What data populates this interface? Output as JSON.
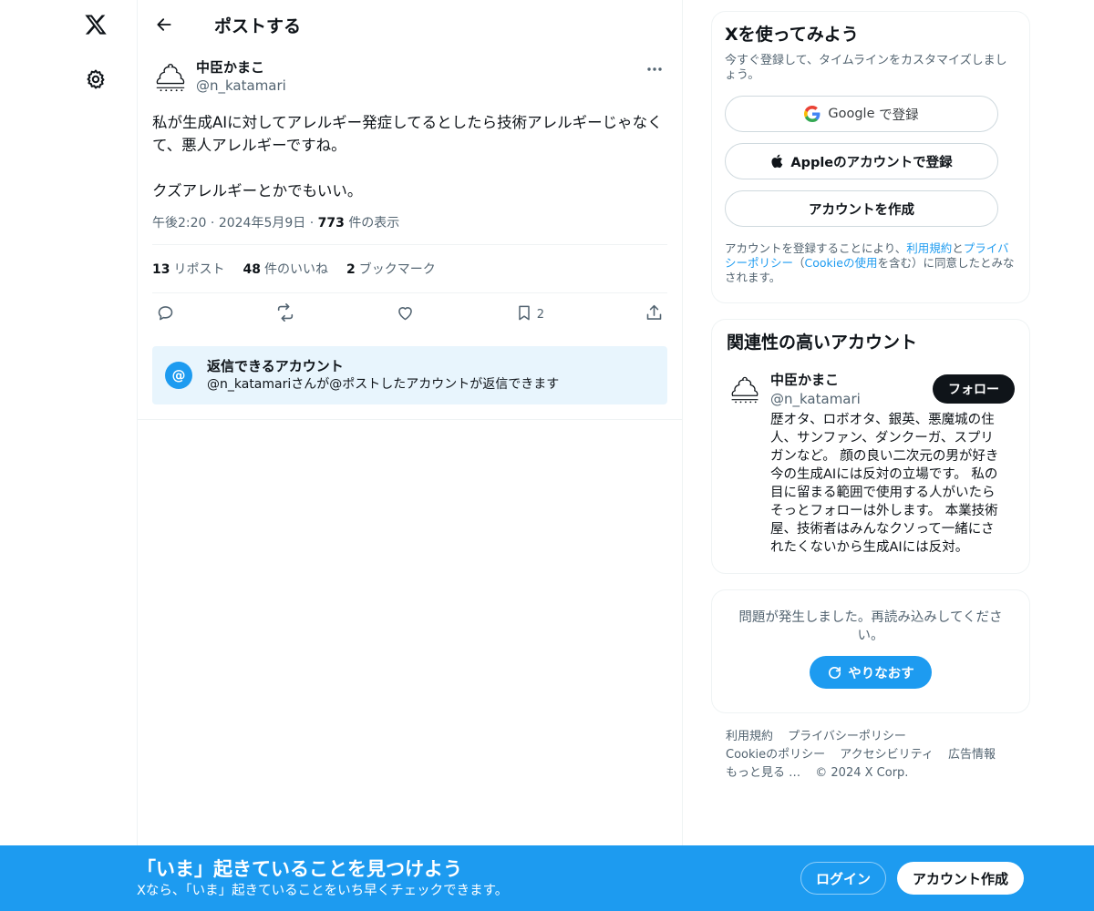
{
  "header": {
    "title": "ポストする"
  },
  "post": {
    "display_name": "中臣かまこ",
    "handle": "@n_katamari",
    "text": "私が生成AIに対してアレルギー発症してるとしたら技術アレルギーじゃなくて、悪人アレルギーですね。\n\nクズアレルギーとかでもいい。",
    "time": "午後2:20",
    "date": "2024年5月9日",
    "views_count": "773",
    "views_label": "件の表示",
    "reposts_count": "13",
    "reposts_label": "リポスト",
    "likes_count": "48",
    "likes_label": "件のいいね",
    "bookmarks_count": "2",
    "bookmarks_label": "ブックマーク",
    "bookmark_action_count": "2"
  },
  "reply_settings": {
    "title": "返信できるアカウント",
    "description": "@n_katamariさんが@ポストしたアカウントが返信できます"
  },
  "signup_card": {
    "title": "Xを使ってみよう",
    "subtitle": "今すぐ登録して、タイムラインをカスタマイズしましょう。",
    "google_label_brand": "Google",
    "google_label_suffix": " で登録",
    "apple_label": "Appleのアカウントで登録",
    "create_label": "アカウントを作成",
    "terms_prefix": "アカウントを登録することにより、",
    "terms_link": "利用規約",
    "terms_and": "と",
    "privacy_link": "プライバシーポリシー",
    "paren_open": "（",
    "cookie_link": "Cookieの使用",
    "terms_suffix": "を含む）に同意したとみなされます。"
  },
  "related": {
    "title": "関連性の高いアカウント",
    "display_name": "中臣かまこ",
    "handle": "@n_katamari",
    "follow_label": "フォロー",
    "bio": "歴オタ、ロボオタ、銀英、悪魔城の住人、サンファン、ダンクーガ、スプリガンなど。 顔の良い二次元の男が好き 今の生成AIには反対の立場です。 私の目に留まる範囲で使用する人がいたらそっとフォローは外します。 本業技術屋、技術者はみんなクソって一緒にされたくないから生成AIには反対。"
  },
  "error_card": {
    "message": "問題が発生しました。再読み込みしてください。",
    "retry_label": "やりなおす"
  },
  "footer": {
    "links": [
      "利用規約",
      "プライバシーポリシー",
      "Cookieのポリシー",
      "アクセシビリティ",
      "広告情報",
      "もっと見る …"
    ],
    "copyright": "© 2024 X Corp."
  },
  "banner": {
    "title": "「いま」起きていることを見つけよう",
    "subtitle": "Xなら、「いま」起きていることをいち早くチェックできます。",
    "login_label": "ログイン",
    "signup_label": "アカウント作成"
  },
  "icons": {
    "logo": "x-logo-icon",
    "settings": "gear-icon",
    "back": "arrow-left-icon",
    "more": "more-horizontal-icon",
    "reply": "reply-icon",
    "repost": "repost-icon",
    "like": "heart-icon",
    "bookmark": "bookmark-icon",
    "share": "share-icon",
    "mention": "at-icon",
    "google": "google-icon",
    "apple": "apple-icon",
    "refresh": "refresh-icon"
  },
  "colors": {
    "accent": "#1d9bf0",
    "text": "#0f1419",
    "muted": "#536471",
    "reply_bg": "#e8f5fd",
    "border": "#eff3f4"
  }
}
